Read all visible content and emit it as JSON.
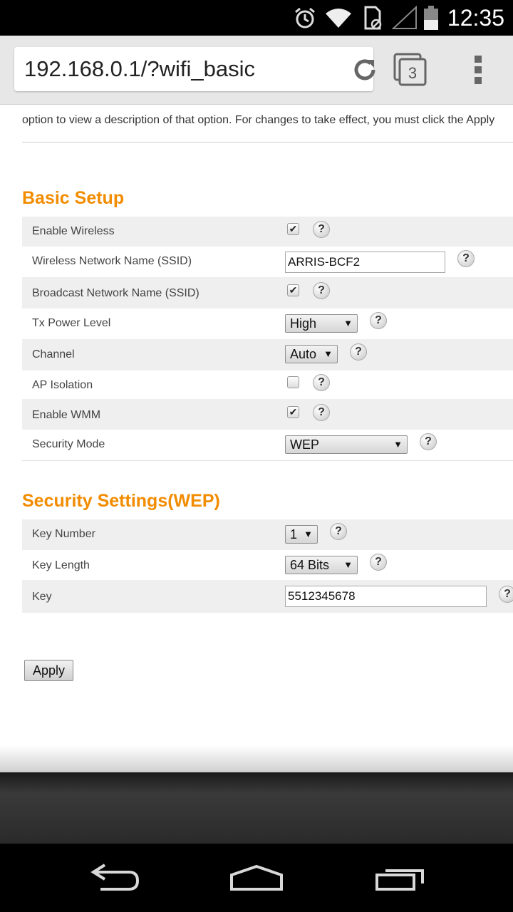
{
  "status_bar": {
    "time": "12:35",
    "icons": [
      "alarm-icon",
      "wifi-icon",
      "sim-card-icon",
      "signal-icon",
      "battery-icon"
    ]
  },
  "browser": {
    "url": "192.168.0.1/?wifi_basic",
    "tab_count": "3",
    "icons": [
      "reload-icon",
      "tabs-icon",
      "overflow-menu-icon"
    ]
  },
  "intro_text": "option to view a description of that option. For changes to take effect, you must click the Apply",
  "basic_setup": {
    "title": "Basic Setup",
    "rows": [
      {
        "label": "Enable Wireless",
        "type": "checkbox",
        "checked": true
      },
      {
        "label": "Wireless Network Name (SSID)",
        "type": "text",
        "value": "ARRIS-BCF2"
      },
      {
        "label": "Broadcast Network Name (SSID)",
        "type": "checkbox",
        "checked": true
      },
      {
        "label": "Tx Power Level",
        "type": "select",
        "value": "High"
      },
      {
        "label": "Channel",
        "type": "select",
        "value": "Auto"
      },
      {
        "label": "AP Isolation",
        "type": "checkbox",
        "checked": false
      },
      {
        "label": "Enable WMM",
        "type": "checkbox",
        "checked": true
      },
      {
        "label": "Security Mode",
        "type": "select",
        "value": "WEP"
      }
    ]
  },
  "security_settings": {
    "title": "Security Settings(WEP)",
    "rows": [
      {
        "label": "Key Number",
        "type": "select",
        "value": "1"
      },
      {
        "label": "Key Length",
        "type": "select",
        "value": "64 Bits"
      },
      {
        "label": "Key",
        "type": "text",
        "value": "5512345678"
      }
    ]
  },
  "help_symbol": "?",
  "check_symbol": "✔",
  "dropdown_arrow": "▼",
  "apply_label": "Apply",
  "colors": {
    "section_title": "#f28c00",
    "row_shade": "#efefef",
    "status_bar_bg": "#000000",
    "toolbar_bg": "#e7e7e7"
  },
  "nav_bar": {
    "icons": [
      "back-icon",
      "home-icon",
      "recents-icon"
    ]
  }
}
